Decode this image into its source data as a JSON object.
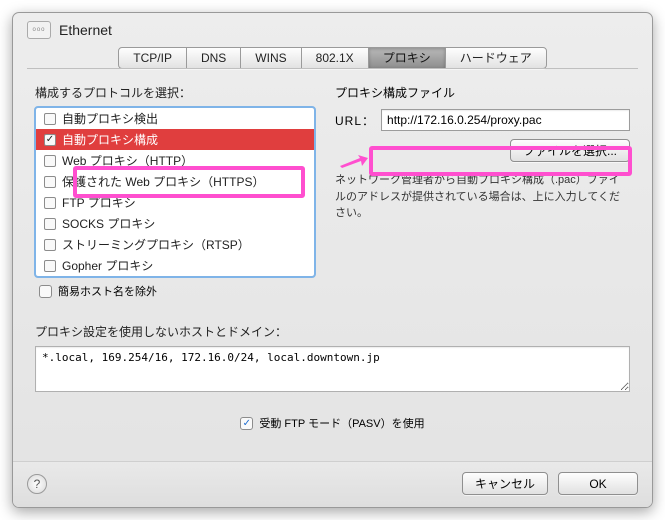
{
  "header": {
    "interface": "Ethernet"
  },
  "tabs": [
    {
      "label": "TCP/IP",
      "active": false
    },
    {
      "label": "DNS",
      "active": false
    },
    {
      "label": "WINS",
      "active": false
    },
    {
      "label": "802.1X",
      "active": false
    },
    {
      "label": "プロキシ",
      "active": true
    },
    {
      "label": "ハードウェア",
      "active": false
    }
  ],
  "left": {
    "title": "構成するプロトコルを選択：",
    "protocols": [
      {
        "label": "自動プロキシ検出",
        "checked": false,
        "selected": false
      },
      {
        "label": "自動プロキシ構成",
        "checked": true,
        "selected": true
      },
      {
        "label": "Web プロキシ（HTTP）",
        "checked": false,
        "selected": false
      },
      {
        "label": "保護された Web プロキシ（HTTPS）",
        "checked": false,
        "selected": false
      },
      {
        "label": "FTP プロキシ",
        "checked": false,
        "selected": false
      },
      {
        "label": "SOCKS プロキシ",
        "checked": false,
        "selected": false
      },
      {
        "label": "ストリーミングプロキシ（RTSP）",
        "checked": false,
        "selected": false
      },
      {
        "label": "Gopher プロキシ",
        "checked": false,
        "selected": false
      }
    ],
    "simpleHostnames": {
      "label": "簡易ホスト名を除外",
      "checked": false
    }
  },
  "right": {
    "title": "プロキシ構成ファイル",
    "urlLabel": "URL：",
    "urlValue": "http://172.16.0.254/proxy.pac",
    "chooseFile": "ファイルを選択...",
    "description": "ネットワーク管理者から自動プロキシ構成（.pac）ファイルのアドレスが提供されている場合は、上に入力してください。"
  },
  "bypass": {
    "label": "プロキシ設定を使用しないホストとドメイン：",
    "value": "*.local, 169.254/16, 172.16.0/24, local.downtown.jp"
  },
  "pasv": {
    "label": "受動 FTP モード（PASV）を使用",
    "checked": true
  },
  "footer": {
    "cancel": "キャンセル",
    "ok": "OK"
  }
}
